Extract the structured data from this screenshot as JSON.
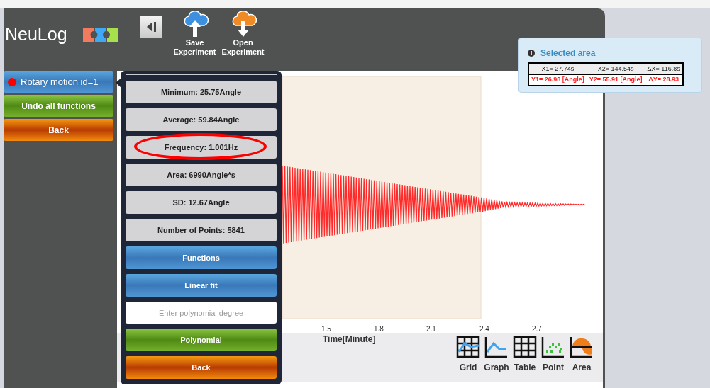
{
  "app": {
    "logo": "NeuLog"
  },
  "toolbar": [
    {
      "label": "Save Experiment",
      "kind": "save"
    },
    {
      "label": "Open Experiment",
      "kind": "open"
    }
  ],
  "sidebar": {
    "sensor": {
      "label": "Rotary motion id=1",
      "color": "#ff0000"
    },
    "buttons": [
      {
        "label": "Undo all functions",
        "kind": "green"
      },
      {
        "label": "Back",
        "kind": "orange"
      }
    ]
  },
  "selected_area": {
    "title": "Selected area",
    "rows": [
      {
        "kind": "x",
        "cells": [
          "X1= 27.74s",
          "X2= 144.54s",
          "ΔX= 116.8s"
        ]
      },
      {
        "kind": "y",
        "cells": [
          "Y1= 26.98 [Angle]",
          "Y2= 55.91 [Angle]",
          "ΔY= 28.93"
        ]
      }
    ]
  },
  "graph": {
    "x_tick_labels": [
      "1.5",
      "1.8",
      "2.1",
      "2.4",
      "2.7"
    ],
    "xlabel": "Time[Minute]"
  },
  "view_buttons": [
    {
      "label": "Grid",
      "kind": "grid"
    },
    {
      "label": "Graph",
      "kind": "graph"
    },
    {
      "label": "Table",
      "kind": "table"
    },
    {
      "label": "Point",
      "kind": "point"
    },
    {
      "label": "Area",
      "kind": "area"
    }
  ],
  "analysis_panel": {
    "stats": [
      {
        "label": "Minimum: 25.75Angle",
        "highlighted": false
      },
      {
        "label": "Average: 59.84Angle",
        "highlighted": false
      },
      {
        "label": "Frequency: 1.001Hz",
        "highlighted": true
      },
      {
        "label": "Area: 6990Angle*s",
        "highlighted": false
      },
      {
        "label": "SD: 12.67Angle",
        "highlighted": false
      },
      {
        "label": "Number of Points: 5841",
        "highlighted": false
      }
    ],
    "buttons": [
      {
        "label": "Functions",
        "kind": "blue"
      },
      {
        "label": "Linear fit",
        "kind": "blue"
      }
    ],
    "degree_field": {
      "placeholder": "Enter polynomial degree"
    },
    "bottom_buttons": [
      {
        "label": "Polynomial",
        "kind": "green"
      },
      {
        "label": "Back",
        "kind": "orange"
      }
    ]
  }
}
